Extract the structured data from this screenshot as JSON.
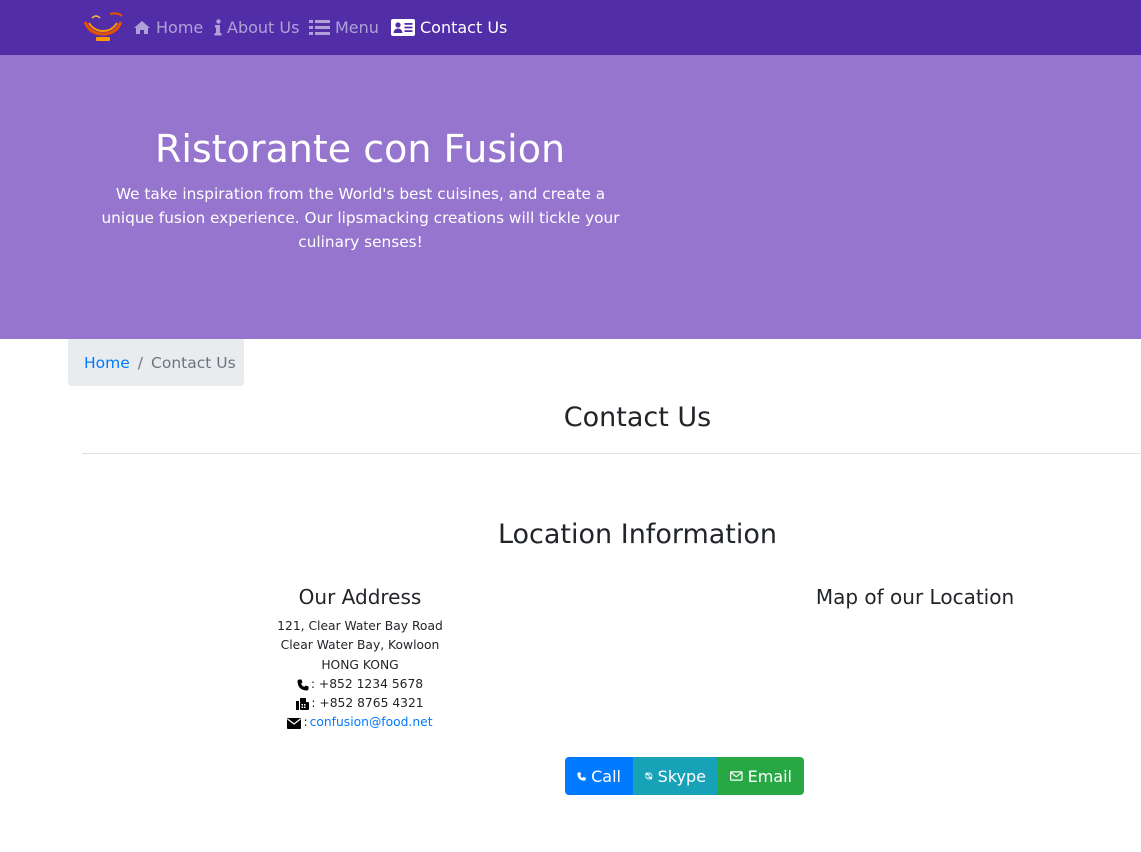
{
  "navbar": {
    "logo": "ristorante-logo",
    "items": [
      {
        "label": "Home",
        "icon": "home-icon",
        "active": false
      },
      {
        "label": "About Us",
        "icon": "info-icon",
        "active": false
      },
      {
        "label": "Menu",
        "icon": "list-icon",
        "active": false
      },
      {
        "label": "Contact Us",
        "icon": "address-card-icon",
        "active": true
      }
    ]
  },
  "jumbotron": {
    "title": "Ristorante con Fusion",
    "text": "We take inspiration from the World's best cuisines, and create a unique fusion experience. Our lipsmacking creations will tickle your culinary senses!"
  },
  "breadcrumb": {
    "items": [
      "Home",
      "Contact Us"
    ],
    "separator": "/"
  },
  "page": {
    "heading": "Contact Us",
    "location_heading": "Location Information",
    "address_heading": "Our Address",
    "map_heading": "Map of our Location"
  },
  "address": {
    "lines": [
      "121, Clear Water Bay Road",
      "Clear Water Bay, Kowloon",
      "HONG KONG"
    ],
    "phone": ": +852 1234 5678",
    "fax": ": +852 8765 4321",
    "email_prefix": ":",
    "email": "confusion@food.net"
  },
  "buttons": [
    {
      "label": "Call",
      "icon": "phone-icon",
      "color": "#007bff"
    },
    {
      "label": "Skype",
      "icon": "skype-icon",
      "color": "#17a2b8"
    },
    {
      "label": "Email",
      "icon": "envelope-icon",
      "color": "#28a745"
    }
  ],
  "colors": {
    "navbar": "#512da8",
    "jumbotron": "#9575cd",
    "link": "#007bff"
  }
}
